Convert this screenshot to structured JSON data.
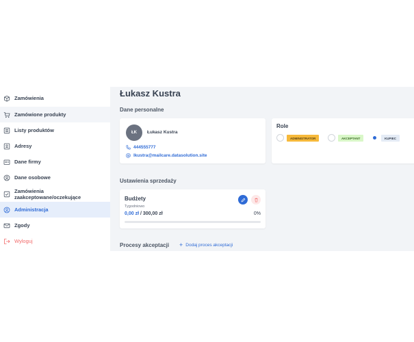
{
  "sidebar": {
    "items": [
      {
        "label": "Zamówienia"
      },
      {
        "label": "Zamówione produkty"
      },
      {
        "label": "Listy produktów"
      },
      {
        "label": "Adresy"
      },
      {
        "label": "Dane firmy"
      },
      {
        "label": "Dane osobowe"
      },
      {
        "label": "Zamówienia zaakceptowane/oczekujące"
      },
      {
        "label": "Administracja"
      },
      {
        "label": "Zgody"
      },
      {
        "label": "Wyloguj"
      }
    ],
    "active_index": 7
  },
  "main": {
    "title": "Łukasz Kustra",
    "personal": {
      "section_title": "Dane personalne",
      "initials": "ŁK",
      "name": "Łukasz Kustra",
      "phone": "444555777",
      "email": "lkustra@mailcare.datasolution.site"
    },
    "roles": {
      "title": "Role",
      "items": [
        {
          "label": "ADMINISTRATOR",
          "checked": false,
          "color": "#f6b93b"
        },
        {
          "label": "AKCEPTANT",
          "checked": false,
          "color": "#d9f7c8"
        },
        {
          "label": "KUPIEC",
          "checked": true,
          "color": "#e4ebf5"
        }
      ]
    },
    "sales": {
      "section_title": "Ustawienia sprzedaży",
      "budget_title": "Budżety",
      "period": "Tygodniowo",
      "spent": "0,00 zł",
      "limit": " / 300,00 zł",
      "percent": "0%",
      "progress": 0
    },
    "acceptance": {
      "section_title": "Procesy akceptacji",
      "add_label": "Dodaj proces akceptacji"
    }
  },
  "colors": {
    "accent": "#2f6bd6",
    "danger": "#f26b6b",
    "background": "#f2f4f7"
  }
}
